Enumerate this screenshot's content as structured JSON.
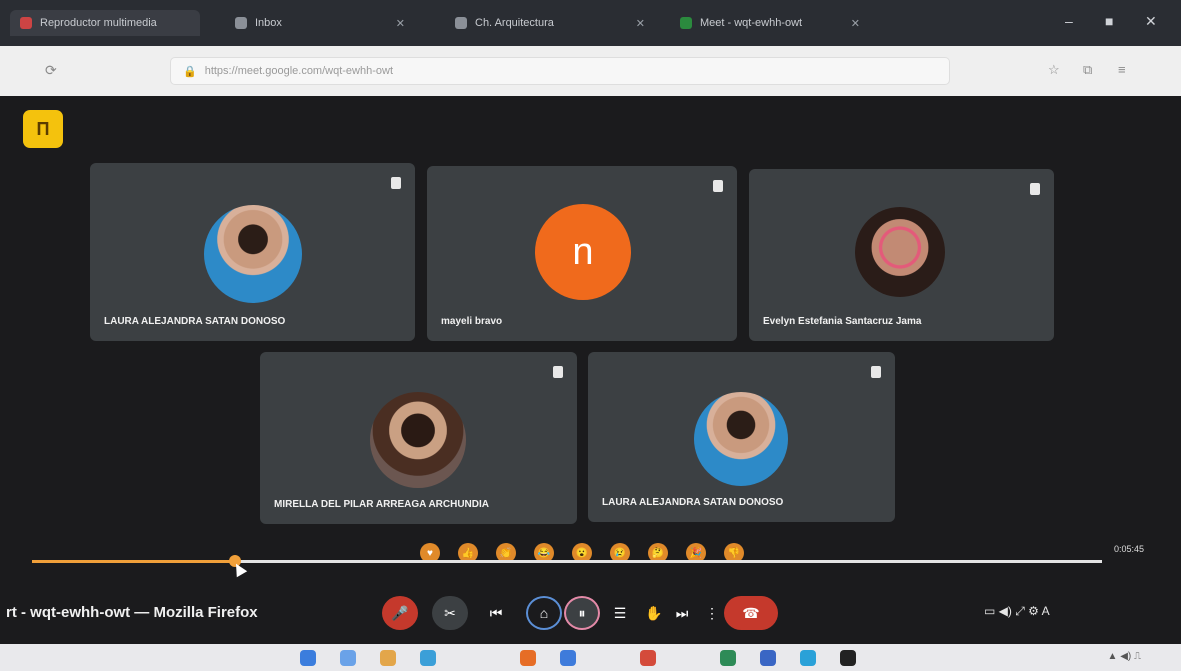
{
  "browser": {
    "tabs": [
      {
        "label": "Reproductor multimedia"
      },
      {
        "label": "Inbox"
      },
      {
        "label": "Ch. Arquitectura"
      },
      {
        "label": "Meet - wqt-ewhh-owt"
      }
    ],
    "window_controls": {
      "minimize": "–",
      "maximize": "■",
      "close": "✕"
    },
    "url": "https://meet.google.com/wqt-ewhh-owt"
  },
  "meet": {
    "logo_letter": "Π",
    "participants": [
      {
        "name": "LAURA ALEJANDRA SATAN DONOSO",
        "avatar": "photo"
      },
      {
        "name": "mayeli bravo",
        "avatar": "letter",
        "initial": "n"
      },
      {
        "name": "Evelyn Estefania Santacruz Jama",
        "avatar": "photo"
      },
      {
        "name": "MIRELLA DEL PILAR ARREAGA ARCHUNDIA",
        "avatar": "photo"
      },
      {
        "name": "LAURA ALEJANDRA SATAN DONOSO",
        "avatar": "photo"
      }
    ]
  },
  "player": {
    "progress": 0.19,
    "time": "0:05:45",
    "reactions": [
      "♥",
      "👍",
      "👏",
      "😂",
      "😮",
      "😢",
      "🤔",
      "🎉",
      "👎"
    ]
  },
  "window_title": "rt - wqt-ewhh-owt — Mozilla Firefox",
  "controls": {
    "mic": "🎤",
    "camera": "✂",
    "prev": "⏮",
    "present": "⌂",
    "pause": "⏸",
    "captions": "☰",
    "raise": "✋",
    "next": "⏭",
    "more": "⋮",
    "leave": "☎"
  },
  "right_controls": "▭ ◀) ⤢ ⚙ A"
}
